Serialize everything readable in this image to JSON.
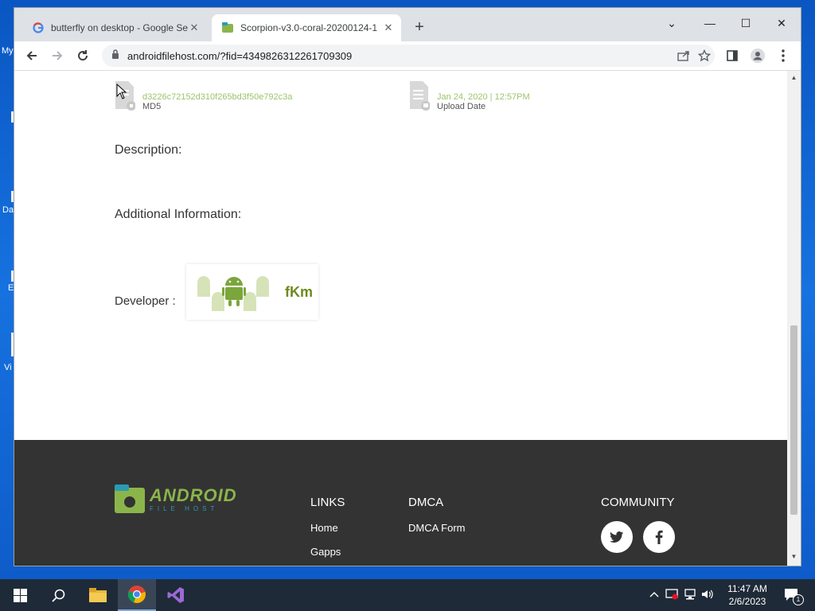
{
  "desktop": {
    "labels": [
      "My",
      "Da",
      "E",
      "Vi"
    ]
  },
  "browser": {
    "tabs": [
      {
        "title": "butterfly on desktop - Google Se",
        "active": false
      },
      {
        "title": "Scorpion-v3.0-coral-20200124-1",
        "active": true
      }
    ],
    "url": "androidfilehost.com/?fid=4349826312261709309",
    "new_tab_symbol": "+",
    "window_controls": {
      "dropdown": "⌄",
      "minimize": "—",
      "maximize": "☐",
      "close": "✕"
    }
  },
  "page": {
    "md5_value": "d3226c72152d310f265bd3f50e792c3a",
    "md5_label": "MD5",
    "upload_value": "Jan 24, 2020 | 12:57PM",
    "upload_label": "Upload Date",
    "description_heading": "Description:",
    "additional_heading": "Additional Information:",
    "developer_label": "Developer :",
    "developer_name": "fKm"
  },
  "footer": {
    "logo_text": "ANDROID",
    "logo_subtext": "FILE HOST",
    "links_heading": "LINKS",
    "links": [
      "Home",
      "Gapps"
    ],
    "dmca_heading": "DMCA",
    "dmca_links": [
      "DMCA Form"
    ],
    "community_heading": "COMMUNITY"
  },
  "taskbar": {
    "time": "11:47 AM",
    "date": "2/6/2023",
    "notification_count": "1"
  },
  "colors": {
    "accent_green": "#9cc46c",
    "footer_bg": "#333333",
    "tab_strip": "#dee1e6"
  }
}
